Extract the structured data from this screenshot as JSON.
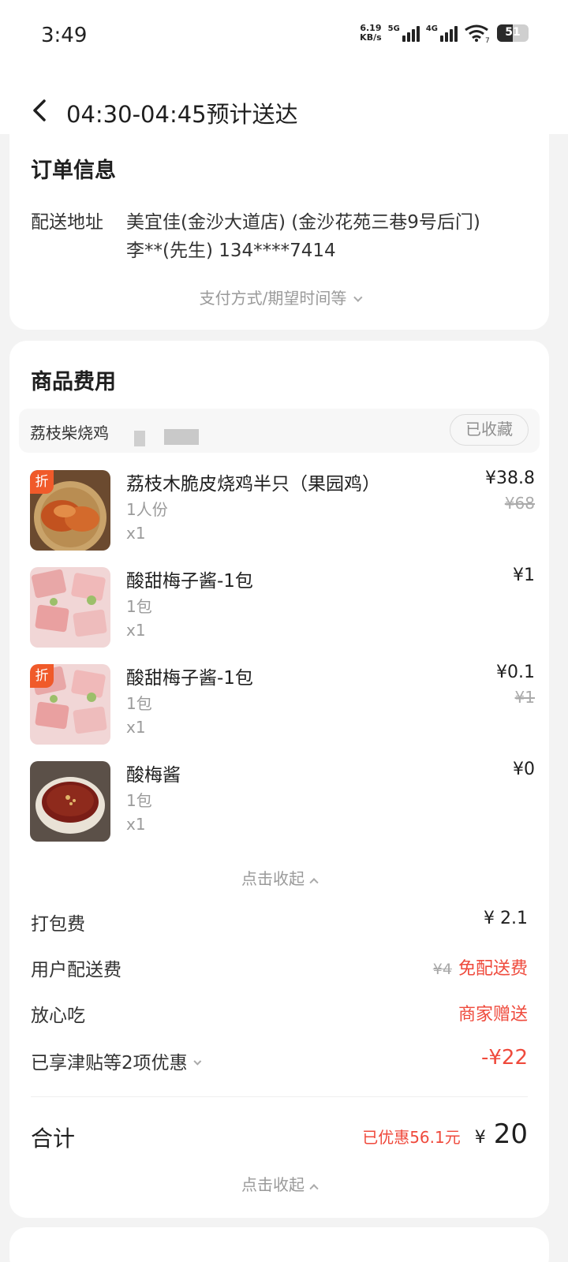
{
  "status_bar": {
    "time": "3:49",
    "net_speed": "6.19",
    "net_unit": "KB/s",
    "sim1_label": "5G",
    "sim2_label": "4G",
    "wifi_sub": "7",
    "battery": "51",
    "battery_level": 0.51
  },
  "header": {
    "title": "04:30-04:45预计送达"
  },
  "order_info": {
    "title": "订单信息",
    "address_label": "配送地址",
    "address_line1": "美宜佳(金沙大道店) (金沙花苑三巷9号后门)",
    "address_line2": "李**(先生) 134****7414",
    "expand_text": "支付方式/期望时间等"
  },
  "goods": {
    "title": "商品费用",
    "shop_name": "荔枝柴烧鸡",
    "favorite_label": "已收藏",
    "items": [
      {
        "name": "荔枝木脆皮烧鸡半只（果园鸡）",
        "spec": "1人份",
        "qty": "x1",
        "price": "¥38.8",
        "original": "¥68",
        "discount_tag": "折"
      },
      {
        "name": "酸甜梅子酱-1包",
        "spec": "1包",
        "qty": "x1",
        "price": "¥1"
      },
      {
        "name": "酸甜梅子酱-1包",
        "spec": "1包",
        "qty": "x1",
        "price": "¥0.1",
        "original": "¥1",
        "discount_tag": "折"
      },
      {
        "name": "酸梅酱",
        "spec": "1包",
        "qty": "x1",
        "price": "¥0"
      }
    ],
    "collapse_text": "点击收起"
  },
  "fees": {
    "packing_label": "打包费",
    "packing_value": "¥ 2.1",
    "delivery_label": "用户配送费",
    "delivery_original": "¥4",
    "delivery_value": "免配送费",
    "assurance_label": "放心吃",
    "assurance_value": "商家赠送",
    "discount_label": "已享津贴等2项优惠",
    "discount_value": "-¥22"
  },
  "total": {
    "label": "合计",
    "saved": "已优惠56.1元",
    "yen": "¥",
    "value": "20",
    "collapse_text": "点击收起"
  },
  "colors": {
    "accent_red": "#ef4a3c",
    "discount_tag": "#f05a2a"
  }
}
